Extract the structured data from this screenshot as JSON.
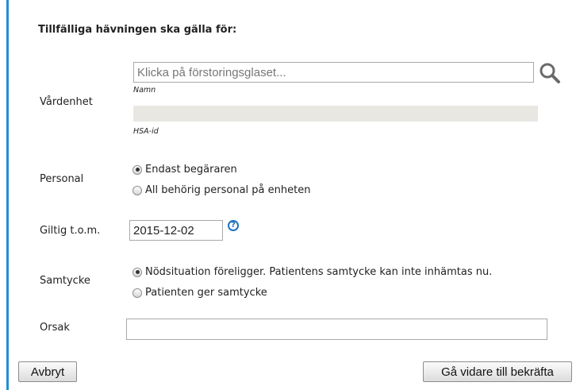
{
  "form": {
    "heading": "Tillfälliga hävningen ska gälla för:",
    "vardenhet": {
      "label": "Vårdenhet",
      "name_placeholder": "Klicka på förstoringsglaset...",
      "name_sublabel": "Namn",
      "hsa_sublabel": "HSA-id"
    },
    "personal": {
      "label": "Personal",
      "options": [
        "Endast begäraren",
        "All behörig personal på enheten"
      ],
      "selected_index": 0
    },
    "giltig": {
      "label": "Giltig t.o.m.",
      "value": "2015-12-02",
      "help_glyph": "?"
    },
    "samtycke": {
      "label": "Samtycke",
      "options": [
        "Nödsituation föreligger. Patientens samtycke kan inte inhämtas nu.",
        "Patienten ger samtycke"
      ],
      "selected_index": 0
    },
    "orsak": {
      "label": "Orsak",
      "value": ""
    }
  },
  "buttons": {
    "cancel": "Avbryt",
    "next": "Gå vidare till bekräfta"
  },
  "icons": {
    "search": "magnifier-icon",
    "help": "question-circle-icon"
  },
  "colors": {
    "accent_bar": "#1f8fd3",
    "help_icon": "#1e73be"
  }
}
